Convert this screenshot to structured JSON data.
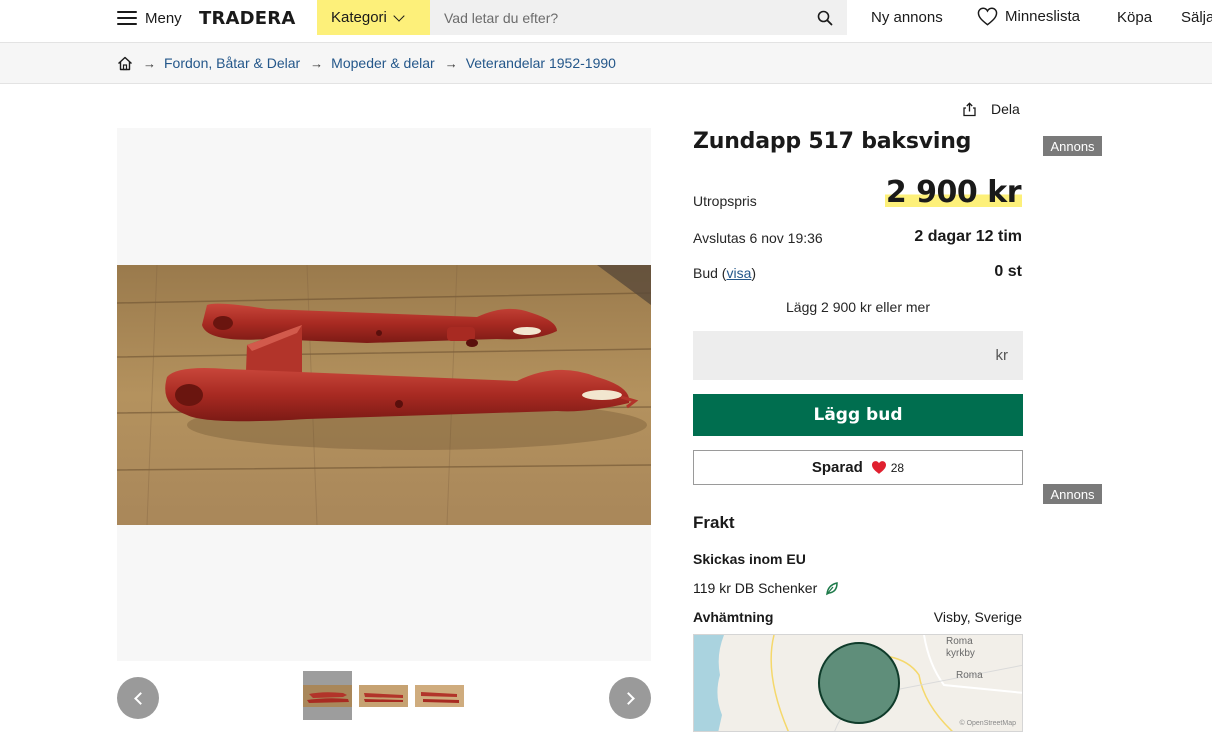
{
  "header": {
    "menu_label": "Meny",
    "logo": "TRADERA",
    "category_label": "Kategori",
    "search_placeholder": "Vad letar du efter?",
    "nav": {
      "new_listing": "Ny annons",
      "wishlist": "Minneslista",
      "buy": "Köpa",
      "sell": "Sälja"
    }
  },
  "breadcrumb": [
    "Fordon, Båtar & Delar",
    "Mopeder & delar",
    "Veterandelar 1952-1990"
  ],
  "listing": {
    "share_label": "Dela",
    "title": "Zundapp 517 baksving",
    "ad_badge": "Annons",
    "price_label": "Utropspris",
    "price": "2 900 kr",
    "ends_label": "Avslutas 6 nov 19:36",
    "time_left": "2 dagar 12 tim",
    "bids_label": "Bud",
    "bids_link": "visa",
    "bids_count": "0 st",
    "bid_hint": "Lägg 2 900 kr eller mer",
    "bid_input_value": "",
    "bid_unit": "kr",
    "bid_button": "Lägg bud",
    "saved_label": "Sparad",
    "saved_count": "28"
  },
  "shipping": {
    "title": "Frakt",
    "region": "Skickas inom EU",
    "option": "119 kr DB Schenker",
    "pickup_label": "Avhämtning",
    "pickup_location": "Visby, Sverige"
  },
  "map": {
    "labels": [
      "Roma kyrkby",
      "Roma"
    ],
    "attribution": "© OpenStreetMap"
  },
  "gallery": {
    "thumbnail_count": 3,
    "active_thumbnail": 1
  },
  "colors": {
    "brand_yellow": "#fdf07a",
    "bid_green": "#006e4f",
    "link_blue": "#24578a",
    "heart_red": "#e0202f",
    "ad_badge_gray": "#7a7a7a"
  }
}
